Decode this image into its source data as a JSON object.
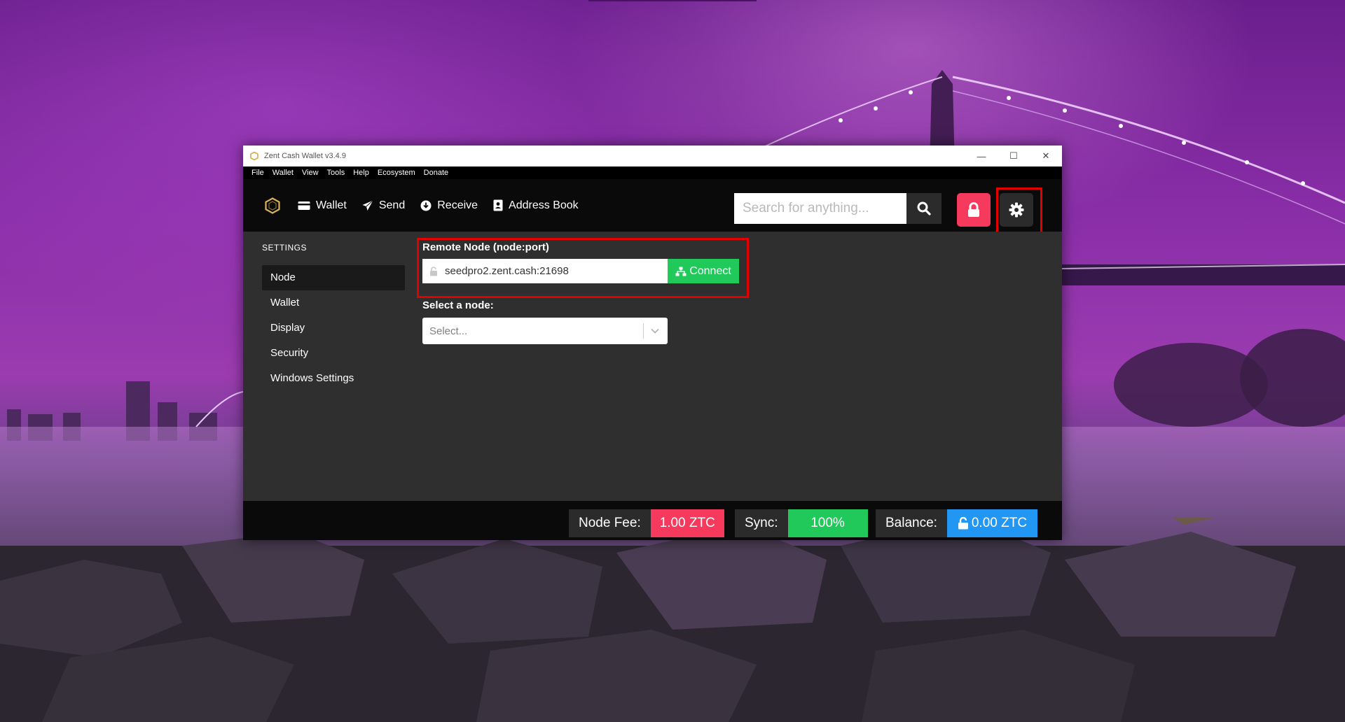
{
  "window": {
    "title": "Zent Cash Wallet v3.4.9",
    "controls": {
      "minimize": "—",
      "maximize": "☐",
      "close": "✕"
    }
  },
  "menu": [
    "File",
    "Wallet",
    "View",
    "Tools",
    "Help",
    "Ecosystem",
    "Donate"
  ],
  "nav": {
    "wallet": "Wallet",
    "send": "Send",
    "receive": "Receive",
    "address_book": "Address Book"
  },
  "search": {
    "placeholder": "Search for anything..."
  },
  "sidebar": {
    "heading": "SETTINGS",
    "items": [
      "Node",
      "Wallet",
      "Display",
      "Security",
      "Windows Settings"
    ],
    "active": "Node"
  },
  "node": {
    "remote_label": "Remote Node (node:port)",
    "value": "seedpro2.zent.cash:21698",
    "connect": "Connect",
    "select_label": "Select a node:",
    "select_placeholder": "Select..."
  },
  "status": {
    "fee_label": "Node Fee:",
    "fee_value": "1.00 ZTC",
    "sync_label": "Sync:",
    "sync_value": "100%",
    "balance_label": "Balance:",
    "balance_value": "0.00 ZTC"
  },
  "colors": {
    "accent_red": "#f53a5d",
    "accent_green": "#20c95a",
    "accent_blue": "#2196f3",
    "highlight": "#e20000"
  }
}
